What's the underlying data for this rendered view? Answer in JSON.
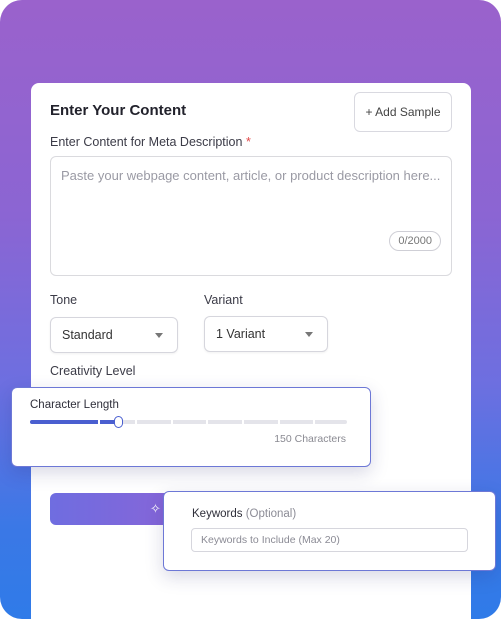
{
  "content_card": {
    "title": "Enter Your Content",
    "add_sample_label": "+ Add Sample",
    "content_label": "Enter Content for Meta Description",
    "required_mark": "*",
    "content_placeholder": "Paste your webpage content, article, or product description here...",
    "char_counter": "0/2000"
  },
  "tone": {
    "label": "Tone",
    "selected": "Standard"
  },
  "variant": {
    "label": "Variant",
    "selected": "1 Variant"
  },
  "creativity": {
    "label": "Creativity Level"
  },
  "character_length": {
    "label": "Character Length",
    "value_text": "150 Characters",
    "fill_fraction": 0.28
  },
  "keywords": {
    "label": "Keywords",
    "optional_note": "(Optional)",
    "placeholder": "Keywords to Include (Max 20)"
  },
  "generate_button": {
    "icon": "magic-wand-icon"
  },
  "colors": {
    "bg_top": "#9a62cc",
    "bg_bottom": "#2f7be8",
    "accent": "#4a5fd0",
    "required": "#e04848"
  }
}
